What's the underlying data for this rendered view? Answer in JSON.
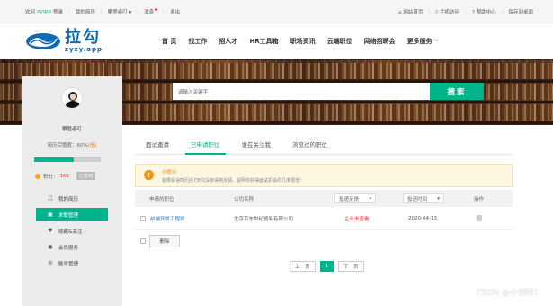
{
  "topbar": {
    "welcome": "欢迎",
    "username": "zyspp",
    "login": "登录",
    "links_left": [
      "我的简历",
      "攀登者叮",
      "消息",
      "退出"
    ],
    "links_right": [
      "网站首页",
      "手机访问",
      "帮助中心",
      "保存到桌面"
    ]
  },
  "logo": {
    "cn": "拉勾",
    "en": "zyzy.app"
  },
  "nav": [
    "首 页",
    "找工作",
    "招人才",
    "HR工具箱",
    "职场资讯",
    "云端职位",
    "网络招聘会",
    "更多服务"
  ],
  "search": {
    "placeholder": "请输入关键字",
    "button": "搜索"
  },
  "sidebar": {
    "username": "攀登者叮",
    "resume_label": "简历完整度：60%",
    "resume_level": "(低)",
    "resume_percent": 60,
    "points_label": "积分：",
    "points_value": "165",
    "signed": "已签到",
    "menu": [
      {
        "label": "我的简历",
        "icon": "user-icon"
      },
      {
        "label": "求职管理",
        "icon": "briefcase-icon"
      },
      {
        "label": "收藏&关注",
        "icon": "heart-icon"
      },
      {
        "label": "会员服务",
        "icon": "member-icon"
      },
      {
        "label": "账号管理",
        "icon": "gear-icon"
      }
    ]
  },
  "tabs": [
    "面试邀请",
    "已申请职位",
    "谁在关注我",
    "浏览过的职位"
  ],
  "tip": {
    "title": "小提示",
    "text": "如果投递简历后7天内没有得到反馈，说明你获得面试机会的几率很低！"
  },
  "table": {
    "headers": [
      "申请的职位",
      "公司名称",
      "投递反馈",
      "投递时间",
      "操作"
    ],
    "rows": [
      {
        "job": "前端开发工程师",
        "company": "北京京东世纪贸易有限公司",
        "status": "企业未查看",
        "date": "2020-04-13"
      }
    ]
  },
  "delete_button": "删除",
  "pager": [
    "上一页",
    "1",
    "下一页"
  ],
  "watermark": "CSDN @小刘哎！",
  "colors": {
    "accent": "#00b38a",
    "logo": "#0f6ab4",
    "warning": "#f0941e",
    "danger": "#ee3333"
  }
}
